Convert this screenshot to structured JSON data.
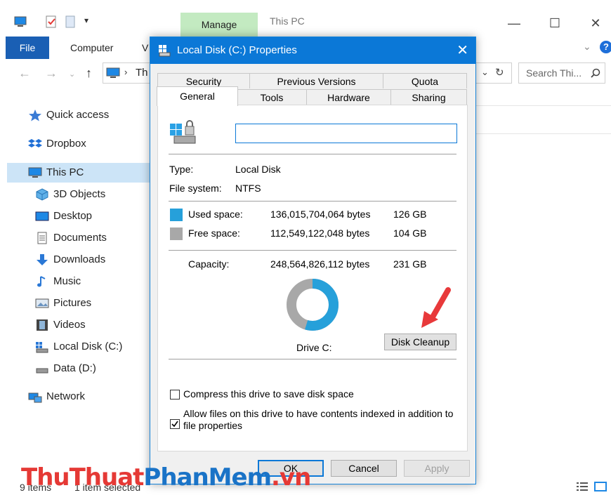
{
  "explorer": {
    "manage_tab": "Manage",
    "window_title": "This PC",
    "ribbon": {
      "file": "File",
      "computer": "Computer",
      "view_partial": "V"
    },
    "address_partial": "Th",
    "search_placeholder": "Search Thi...",
    "nav": [
      {
        "label": "Quick access",
        "icon": "star-icon"
      },
      {
        "label": "Dropbox",
        "icon": "dropbox-icon"
      },
      {
        "label": "This PC",
        "icon": "computer-icon"
      },
      {
        "label": "3D Objects",
        "icon": "cube-icon"
      },
      {
        "label": "Desktop",
        "icon": "desktop-icon"
      },
      {
        "label": "Documents",
        "icon": "document-icon"
      },
      {
        "label": "Downloads",
        "icon": "download-arrow-icon"
      },
      {
        "label": "Music",
        "icon": "music-note-icon"
      },
      {
        "label": "Pictures",
        "icon": "picture-icon"
      },
      {
        "label": "Videos",
        "icon": "film-icon"
      },
      {
        "label": "Local Disk (C:)",
        "icon": "drive-icon"
      },
      {
        "label": "Data (D:)",
        "icon": "drive-icon"
      },
      {
        "label": "Network",
        "icon": "network-icon"
      }
    ],
    "status": {
      "items": "9 items",
      "selected": "1 item selected"
    }
  },
  "dialog": {
    "title": "Local Disk (C:) Properties",
    "tabs_back": [
      "Security",
      "Previous Versions",
      "Quota"
    ],
    "tabs_front": [
      "General",
      "Tools",
      "Hardware",
      "Sharing"
    ],
    "name_value": "",
    "type_label": "Type:",
    "type_value": "Local Disk",
    "fs_label": "File system:",
    "fs_value": "NTFS",
    "used_label": "Used space:",
    "used_bytes": "136,015,704,064 bytes",
    "used_gb": "126 GB",
    "free_label": "Free space:",
    "free_bytes": "112,549,122,048 bytes",
    "free_gb": "104 GB",
    "capacity_label": "Capacity:",
    "capacity_bytes": "248,564,826,112 bytes",
    "capacity_gb": "231 GB",
    "drive_label": "Drive C:",
    "disk_cleanup": "Disk Cleanup",
    "compress_label": "Compress this drive to save disk space",
    "compress_checked": false,
    "index_label": "Allow files on this drive to have contents indexed in addition to file properties",
    "index_checked": true,
    "ok": "OK",
    "cancel": "Cancel",
    "apply": "Apply",
    "used_fraction": 0.547,
    "colors": {
      "used": "#26a0da",
      "free": "#a8a8a8",
      "accent": "#0b78d7"
    }
  },
  "watermark": {
    "part1": "ThuThuat",
    "part2": "PhanMem",
    "part3": ".vn"
  }
}
